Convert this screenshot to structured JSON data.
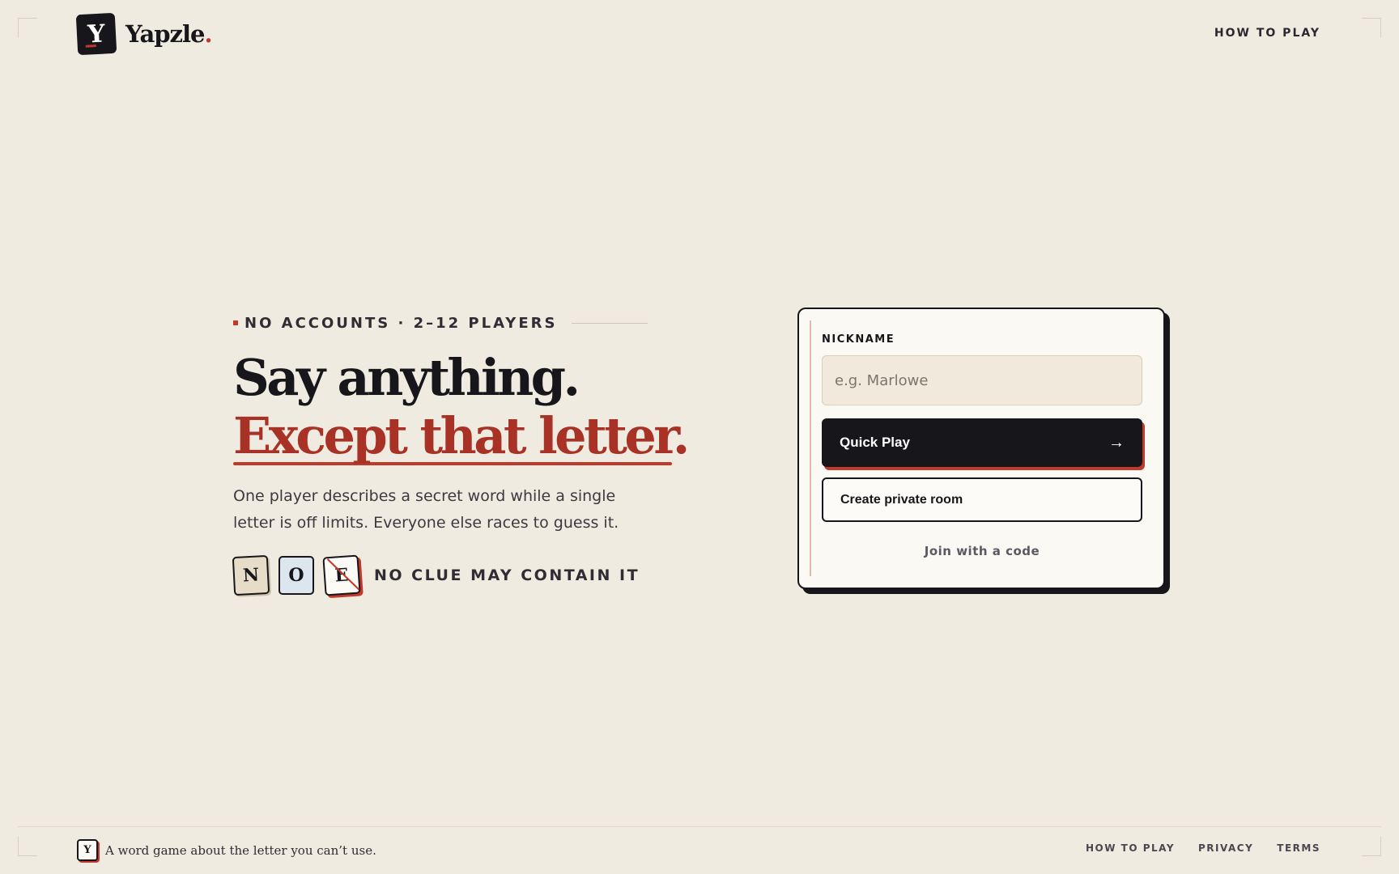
{
  "header": {
    "logo_letter": "Y",
    "brand": "Yapzle",
    "brand_dot": ".",
    "nav_how_to_play": "HOW TO PLAY"
  },
  "hero": {
    "eyebrow": "NO ACCOUNTS · 2–12 PLAYERS",
    "headline_line1": "Say anything.",
    "headline_line2": "Except that letter.",
    "lead_line1": "One player describes a secret word while a single",
    "lead_line2": "letter is off limits. Everyone else races to guess it.",
    "tiles": [
      "N",
      "O",
      "E"
    ],
    "tiles_caption": "NO CLUE MAY CONTAIN IT"
  },
  "card": {
    "nickname_label": "NICKNAME",
    "nickname_placeholder": "e.g. Marlowe",
    "nickname_value": "",
    "quick_play_label": "Quick Play",
    "quick_play_icon": "arrow-right-icon",
    "create_room_label": "Create private room",
    "join_code_label": "Join with a code"
  },
  "footer": {
    "logo_letter": "Y",
    "tagline": "A word game about the letter you can’t use.",
    "links": [
      "HOW TO PLAY",
      "PRIVACY",
      "TERMS"
    ]
  },
  "colors": {
    "background": "#f0ebe0",
    "ink": "#17161a",
    "accent_red": "#c0392b",
    "card": "#fbf9f4"
  }
}
